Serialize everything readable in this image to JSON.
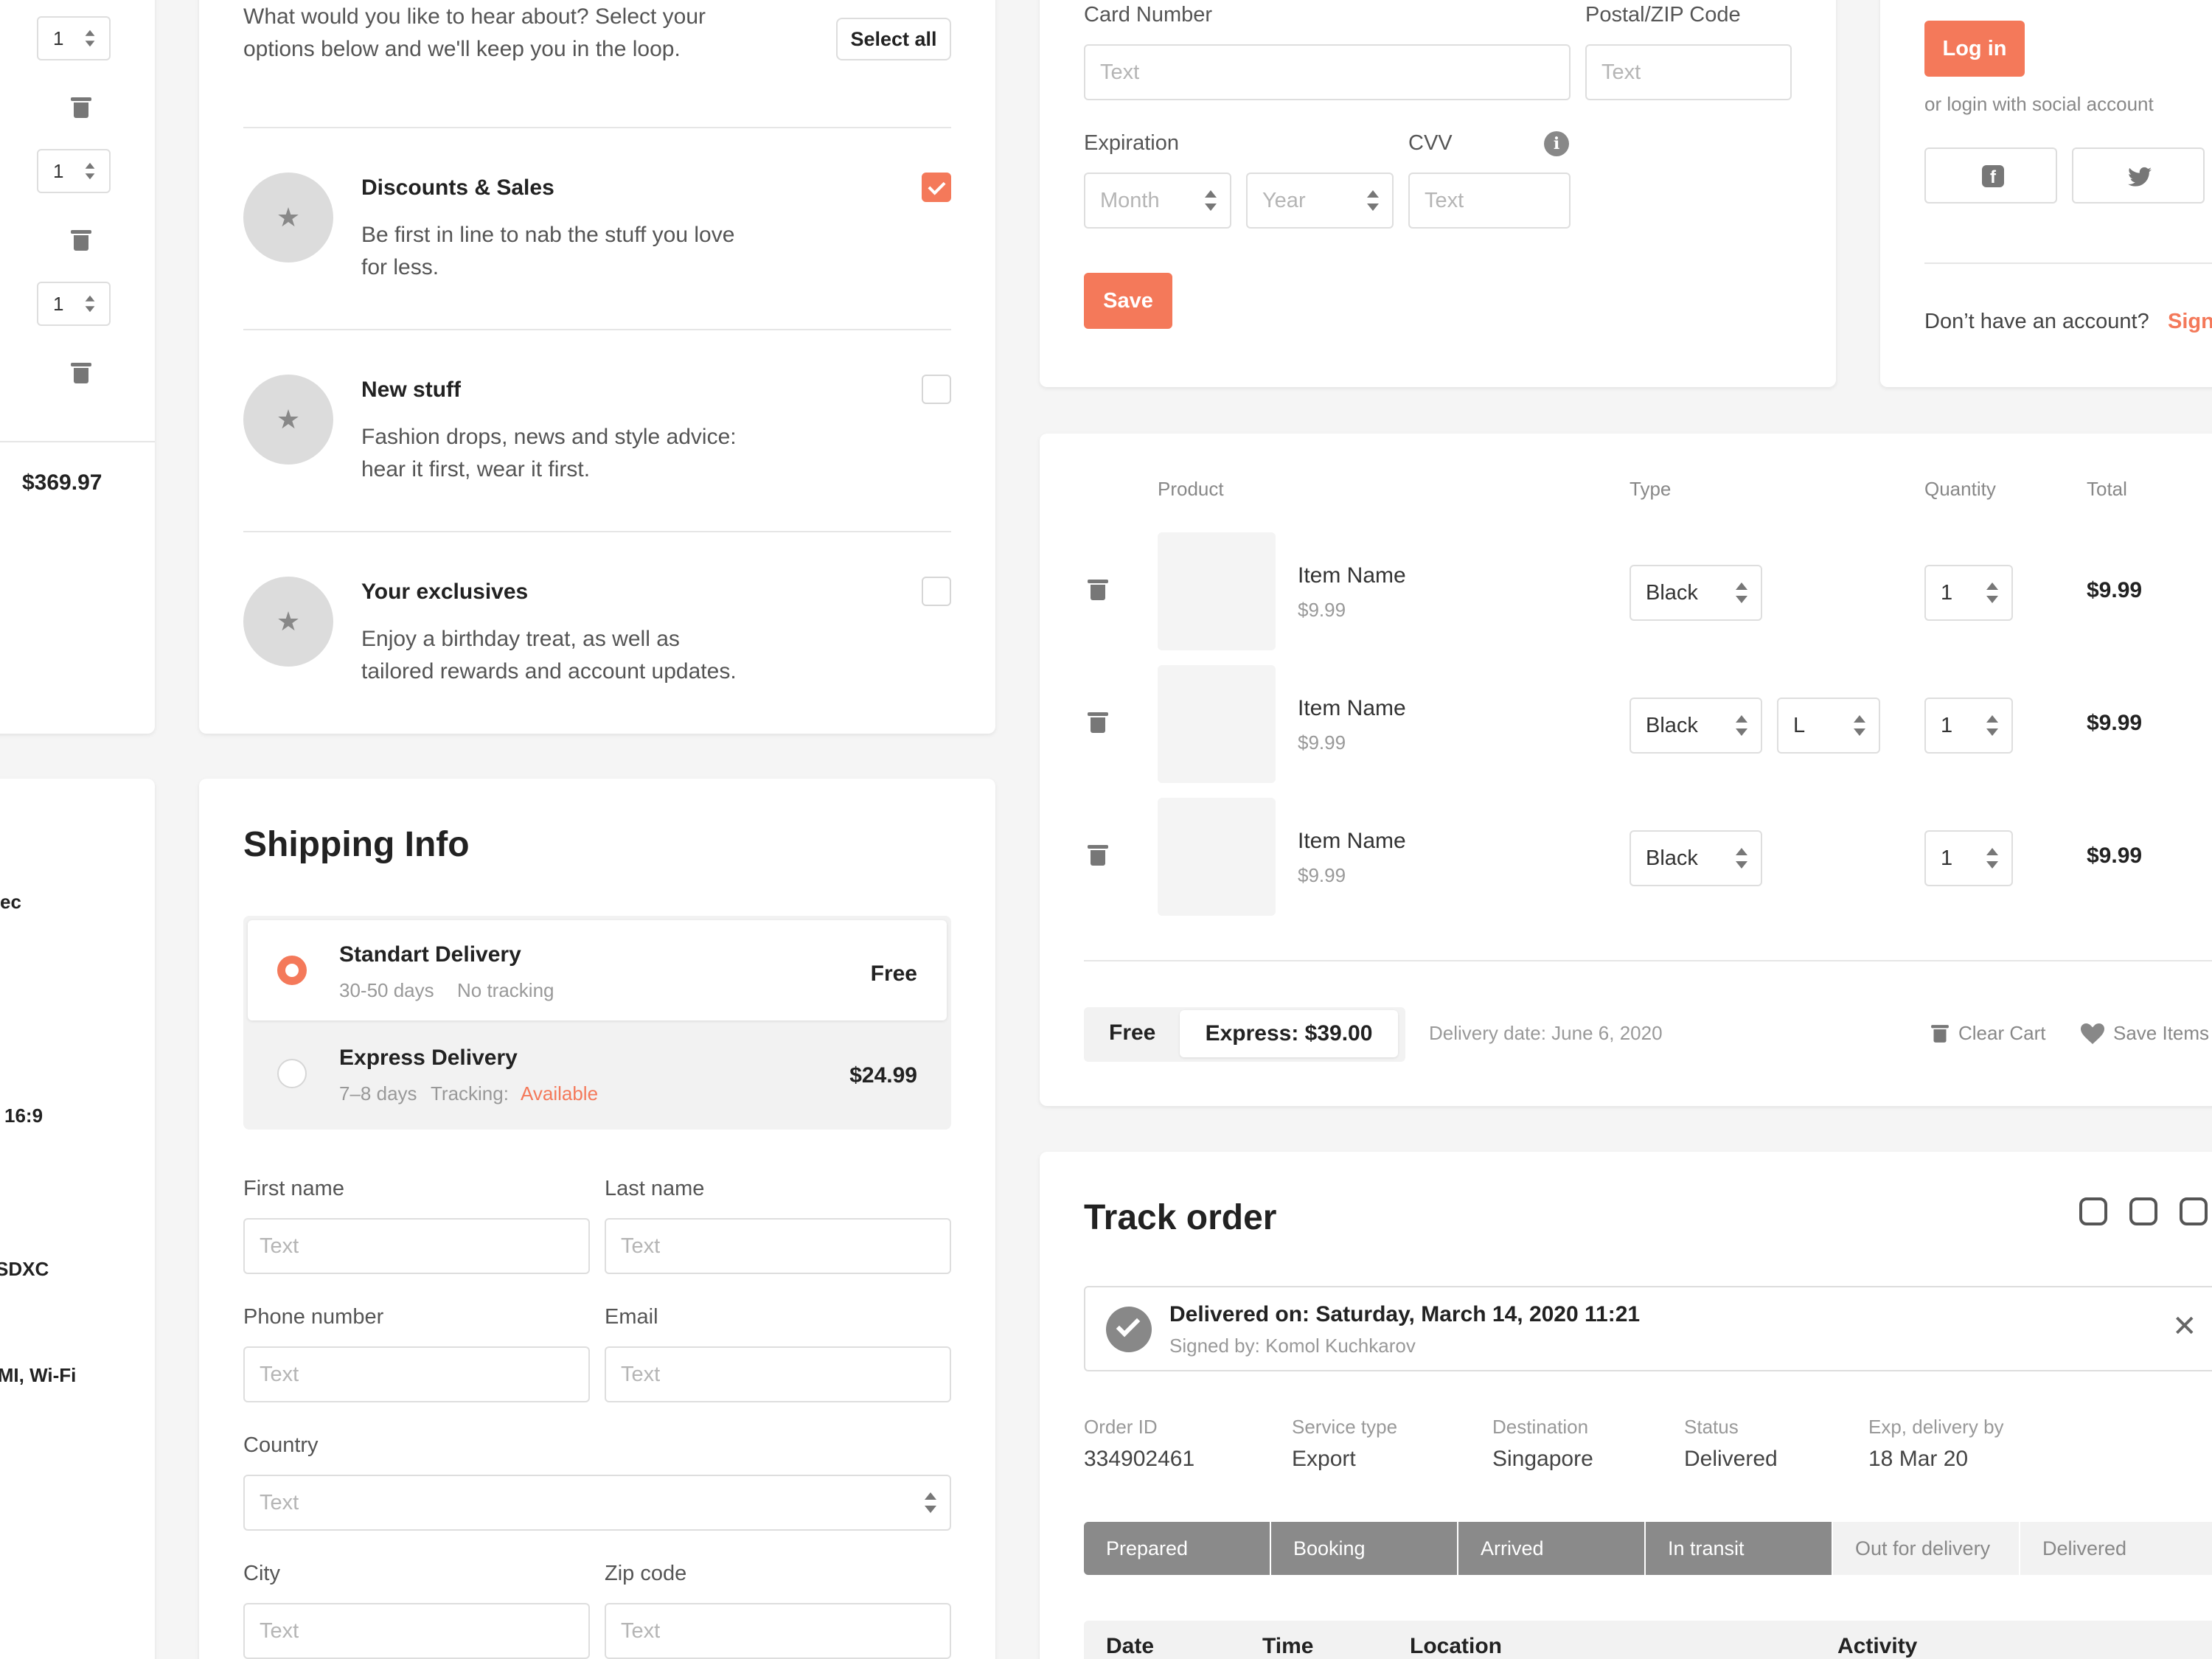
{
  "left_strip": {
    "qty_values": [
      "1",
      "1",
      "1"
    ],
    "total": "$369.97",
    "spec_fragments": [
      "ec",
      "16:9",
      "SDXC",
      "DMI, Wi-Fi"
    ]
  },
  "newsletter": {
    "intro_line1": "What would you like to hear about? Select your",
    "intro_line2": "options below and we'll keep you in the loop.",
    "select_all": "Select all",
    "items": [
      {
        "title": "Discounts & Sales",
        "line1": "Be first in line to nab the stuff you love",
        "line2": "for less.",
        "checked": true
      },
      {
        "title": "New stuff",
        "line1": "Fashion drops, news and style advice:",
        "line2": "hear it first, wear it first.",
        "checked": false
      },
      {
        "title": "Your exclusives",
        "line1": "Enjoy a birthday treat, as well as",
        "line2": "tailored rewards and account updates.",
        "checked": false
      }
    ],
    "star": "★"
  },
  "payment": {
    "card_number_label": "Card Number",
    "card_number_placeholder": "Text",
    "zip_label": "Postal/ZIP Code",
    "zip_placeholder": "Text",
    "expiration_label": "Expiration",
    "month_placeholder": "Month",
    "year_placeholder": "Year",
    "cvv_label": "CVV",
    "cvv_placeholder": "Text",
    "info_icon": "i",
    "save": "Save"
  },
  "login": {
    "login_button": "Log in",
    "social_text": "or login with social account",
    "facebook_icon": "f",
    "no_account": "Don’t have an account?",
    "sign_up": "Sign"
  },
  "cart": {
    "headers": {
      "product": "Product",
      "type": "Type",
      "quantity": "Quantity",
      "total": "Total"
    },
    "rows": [
      {
        "name": "Item Name",
        "price": "$9.99",
        "type": "Black",
        "size": "",
        "qty": "1",
        "total": "$9.99"
      },
      {
        "name": "Item Name",
        "price": "$9.99",
        "type": "Black",
        "size": "L",
        "qty": "1",
        "total": "$9.99"
      },
      {
        "name": "Item Name",
        "price": "$9.99",
        "type": "Black",
        "size": "",
        "qty": "1",
        "total": "$9.99"
      }
    ],
    "free": "Free",
    "express": "Express: $39.00",
    "delivery_date": "Delivery date: June 6, 2020",
    "clear_cart": "Clear Cart",
    "save_items": "Save Items"
  },
  "shipping": {
    "title": "Shipping Info",
    "options": [
      {
        "name": "Standart Delivery",
        "days": "30-50 days",
        "tracking": "No tracking",
        "tracking_value": "",
        "price": "Free",
        "selected": true
      },
      {
        "name": "Express Delivery",
        "days": "7–8 days",
        "tracking": "Tracking:",
        "tracking_value": "Available",
        "price": "$24.99",
        "selected": false
      }
    ],
    "first_name_label": "First name",
    "last_name_label": "Last name",
    "phone_label": "Phone number",
    "email_label": "Email",
    "country_label": "Country",
    "city_label": "City",
    "zip_label": "Zip code",
    "placeholder": "Text"
  },
  "track": {
    "title": "Track order",
    "delivered_title": "Delivered on: Saturday, March 14, 2020 11:21",
    "signed_by": "Signed by: Komol Kuchkarov",
    "info": [
      {
        "label": "Order ID",
        "value": "334902461"
      },
      {
        "label": "Service type",
        "value": "Export"
      },
      {
        "label": "Destination",
        "value": "Singapore"
      },
      {
        "label": "Status",
        "value": "Delivered"
      },
      {
        "label": "Exp, delivery by",
        "value": "18 Mar 20"
      }
    ],
    "steps": [
      {
        "label": "Prepared",
        "done": true
      },
      {
        "label": "Booking",
        "done": true
      },
      {
        "label": "Arrived",
        "done": true
      },
      {
        "label": "In transit",
        "done": true
      },
      {
        "label": "Out for delivery",
        "done": false
      },
      {
        "label": "Delivered",
        "done": false
      }
    ],
    "table_headers": [
      "Date",
      "Time",
      "Location",
      "Activity"
    ],
    "close_icon": "✕"
  },
  "colors": {
    "accent": "#f4795a",
    "muted": "#9a9a9a",
    "step_done": "#8a8a8a"
  }
}
